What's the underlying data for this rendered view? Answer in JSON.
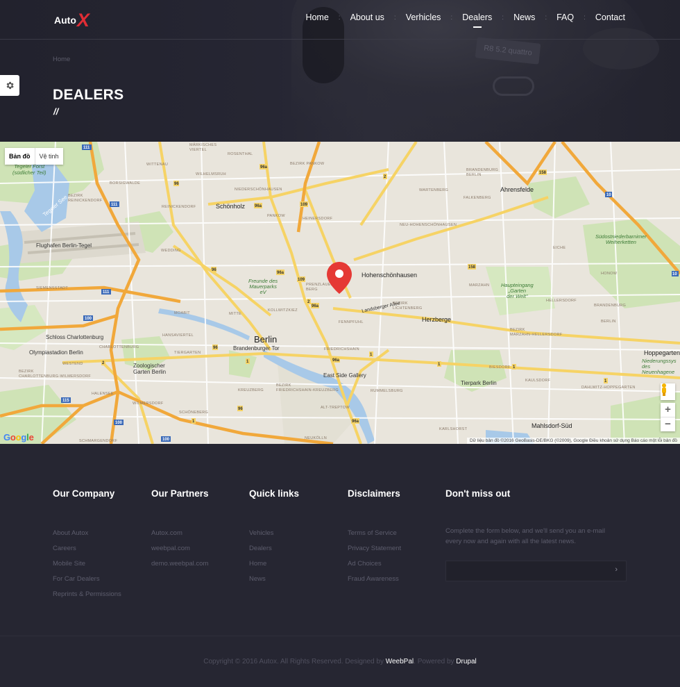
{
  "brand": {
    "auto": "Auto",
    "x": "X"
  },
  "nav": {
    "items": [
      {
        "label": "Home"
      },
      {
        "label": "About us"
      },
      {
        "label": "Verhicles"
      },
      {
        "label": "Dealers",
        "active": true
      },
      {
        "label": "News"
      },
      {
        "label": "FAQ"
      },
      {
        "label": "Contact"
      }
    ],
    "separator": ":"
  },
  "hero": {
    "plate_text": "R8 5.2 quattro"
  },
  "breadcrumb": "Home",
  "page_title": "DEALERS",
  "page_title_mark": "//",
  "map": {
    "type_control": {
      "map": "Bản đồ",
      "satellite": "Vệ tinh"
    },
    "attribution": "Dữ liệu bản đồ ©2016 GeoBasis-DE/BKG (©2009), Google   Điều khoản sử dụng   Báo cáo một lỗi bản đồ",
    "logo": "Google",
    "zoom_in": "+",
    "zoom_out": "−",
    "labels": {
      "berlin": "Berlin",
      "hohenschonhausen": "Hohenschönhausen",
      "ahrensfelde": "Ahrensfelde",
      "herzberge": "Herzberge",
      "schonholz": "Schönholz",
      "tegel": "Flughafen Berlin-Tegel",
      "mahlsdorf": "Mahlsdorf-Süd",
      "tegeler_see": "Tegeler See",
      "tegeler_forst": "Tegeler Forst\n(südlicher Teil)",
      "schloss": "Schloss Charlottenburg",
      "olympia": "Olympiastadion Berlin",
      "zoo": "Zoologischer\nGarten Berlin",
      "brandenburger": "Brandenburger Tor",
      "eastside": "East Side Gallery",
      "tierpark": "Tierpark Berlin",
      "mauerpark": "Freunde des\nMauerparks\neV",
      "haupteingang": "Haupteingang\n„Garten\nder Welt\"",
      "sudost": "Südostniederbarnimer\nWeiherketten",
      "hoppegarten": "Hoppegarten",
      "niederungssys": "Niederungssys\ndes\nNeuenhagene",
      "kreuzberg": "KREUZBERG",
      "friedrichshain": "FRIEDRICHSHAIN",
      "lichtenberg": "BEZIRK\nLICHTENBERG",
      "mitte": "MITTE",
      "moabit": "MOABIT",
      "pankow": "PANKOW",
      "wedding": "WEDDING",
      "marzahn": "MARZAHN",
      "falkenberg": "FALKENBERG",
      "wartenberg": "WARTENBERG",
      "rosenthal": "ROSENTHAL",
      "wittenau": "WITTENAU",
      "siemensstadt": "SIEMENSSTADT",
      "charlottenburg": "CHARLOTTENBURG",
      "westend": "WESTEND",
      "halensee": "HALENSEE",
      "wilmersdorf": "WILMERSDORF",
      "schoneberg": "SCHÖNEBERG",
      "tiergarten": "TIERGARTEN",
      "rummelsburg": "RUMMELSBURG",
      "biesdorf": "BIESDORF",
      "kaulsdorf": "KAULSDORF",
      "hellersdorf": "HELLERSDORF",
      "brandenburg": "BRANDENBURG",
      "berlin_dist": "BERLIN",
      "friedrichshain_kreuzberg": "BEZIRK\nFRIEDRICHSHAIN-KREUZBERG",
      "alt_treptow": "ALT-TREPTOW",
      "karlshorst": "KARLSHORST",
      "neukolln": "NEUKÖLLN",
      "landsberger": "Landsberger Allee",
      "fennpfuhl": "FENNPFUHL",
      "prenzlauer": "PRENZLAUER\nBERG",
      "kollwitzkiez": "KOLLWITZKIEZ",
      "eiche": "EICHE",
      "honow": "HONOW",
      "hansaviertel": "HANSAVIERTEL",
      "niederschonhausen": "NIEDERSCHÖNHAUSEN",
      "heinersdorf": "HEINERSDORF",
      "reinickendorf": "REINICKENDORF",
      "borsigwalde": "BORSIGWALDE",
      "markisches": "MÄRKISCHES\nVIERTEL",
      "wilhelmsruh": "WILHELMSRUH",
      "neu_hohen": "NEU-HOHENSCHÖNHAUSEN",
      "grossbezirk": "BEZIRK\nREINICKENDORF",
      "bez_pankow": "BEZIRK PANKOW",
      "bez_marzahn": "BEZIRK\nMARZAHN-HELLERSDORF",
      "bez_cw": "BEZIRK\nCHARLOTTENBURG-WILMERSDORF",
      "brandenburg_berlin": "BRANDENBURG\nBERLIN",
      "schmargendorf": "SCHMARGENDORF",
      "dahlwitz": "DAHLWITZ-HOPPEGARTEN"
    }
  },
  "footer": {
    "columns": [
      {
        "title": "Our Company",
        "links": [
          "About Autox",
          "Careers",
          "Mobile Site",
          "For Car Dealers",
          "Reprints & Permissions"
        ]
      },
      {
        "title": "Our Partners",
        "links": [
          "Autox.com",
          "weebpal.com",
          "demo.weebpal.com"
        ]
      },
      {
        "title": "Quick links",
        "links": [
          "Vehicles",
          "Dealers",
          "Home",
          "News"
        ]
      },
      {
        "title": "Disclaimers",
        "links": [
          "Terms of Service",
          "Privacy Statement",
          "Ad Choices",
          "Fraud Awareness"
        ]
      }
    ],
    "newsletter": {
      "title": "Don't miss out",
      "text": "Complete the form below, and we'll send you an e-mail every now and again with all the latest news.",
      "placeholder": "",
      "submit_icon": "›"
    },
    "copyright": {
      "prefix": "Copyright © 2016 Autox. All Rights Reserved. Designed by ",
      "designer": "WeebPal",
      "middle": ". Powered by ",
      "platform": "Drupal"
    }
  }
}
